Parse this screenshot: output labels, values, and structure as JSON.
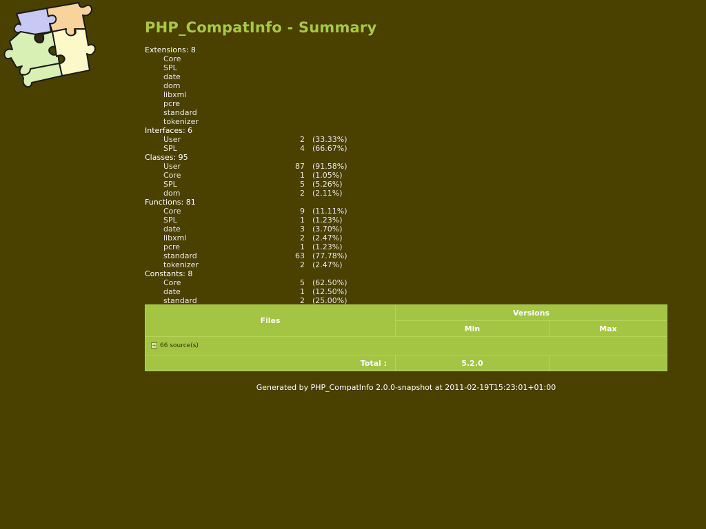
{
  "title": "PHP_CompatInfo - Summary",
  "logo": "puzzle-logo",
  "groups": [
    {
      "heading": "Extensions: 8",
      "items": [
        {
          "name": "Core",
          "count": "",
          "pct": ""
        },
        {
          "name": "SPL",
          "count": "",
          "pct": ""
        },
        {
          "name": "date",
          "count": "",
          "pct": ""
        },
        {
          "name": "dom",
          "count": "",
          "pct": ""
        },
        {
          "name": "libxml",
          "count": "",
          "pct": ""
        },
        {
          "name": "pcre",
          "count": "",
          "pct": ""
        },
        {
          "name": "standard",
          "count": "",
          "pct": ""
        },
        {
          "name": "tokenizer",
          "count": "",
          "pct": ""
        }
      ]
    },
    {
      "heading": "Interfaces: 6",
      "items": [
        {
          "name": "User",
          "count": "2",
          "pct": "(33.33%)"
        },
        {
          "name": "SPL",
          "count": "4",
          "pct": "(66.67%)"
        }
      ]
    },
    {
      "heading": "Classes: 95",
      "items": [
        {
          "name": "User",
          "count": "87",
          "pct": "(91.58%)"
        },
        {
          "name": "Core",
          "count": "1",
          "pct": "(1.05%)"
        },
        {
          "name": "SPL",
          "count": "5",
          "pct": "(5.26%)"
        },
        {
          "name": "dom",
          "count": "2",
          "pct": "(2.11%)"
        }
      ]
    },
    {
      "heading": "Functions: 81",
      "items": [
        {
          "name": "Core",
          "count": "9",
          "pct": "(11.11%)"
        },
        {
          "name": "SPL",
          "count": "1",
          "pct": "(1.23%)"
        },
        {
          "name": "date",
          "count": "3",
          "pct": "(3.70%)"
        },
        {
          "name": "libxml",
          "count": "2",
          "pct": "(2.47%)"
        },
        {
          "name": "pcre",
          "count": "1",
          "pct": "(1.23%)"
        },
        {
          "name": "standard",
          "count": "63",
          "pct": "(77.78%)"
        },
        {
          "name": "tokenizer",
          "count": "2",
          "pct": "(2.47%)"
        }
      ]
    },
    {
      "heading": "Constants: 8",
      "items": [
        {
          "name": "Core",
          "count": "5",
          "pct": "(62.50%)"
        },
        {
          "name": "date",
          "count": "1",
          "pct": "(12.50%)"
        },
        {
          "name": "standard",
          "count": "2",
          "pct": "(25.00%)"
        }
      ]
    }
  ],
  "table": {
    "files_header": "Files",
    "versions_header": "Versions",
    "min_header": "Min",
    "max_header": "Max",
    "sources_toggle": "+",
    "sources_label": "66 source(s)",
    "total_label": "Total :",
    "total_min": "5.2.0",
    "total_max": ""
  },
  "footer": "Generated by PHP_CompatInfo 2.0.0-snapshot at 2011-02-19T15:23:01+01:00",
  "colors": {
    "background": "#4a4000",
    "title": "#a8c846",
    "table": "#a4c444"
  }
}
